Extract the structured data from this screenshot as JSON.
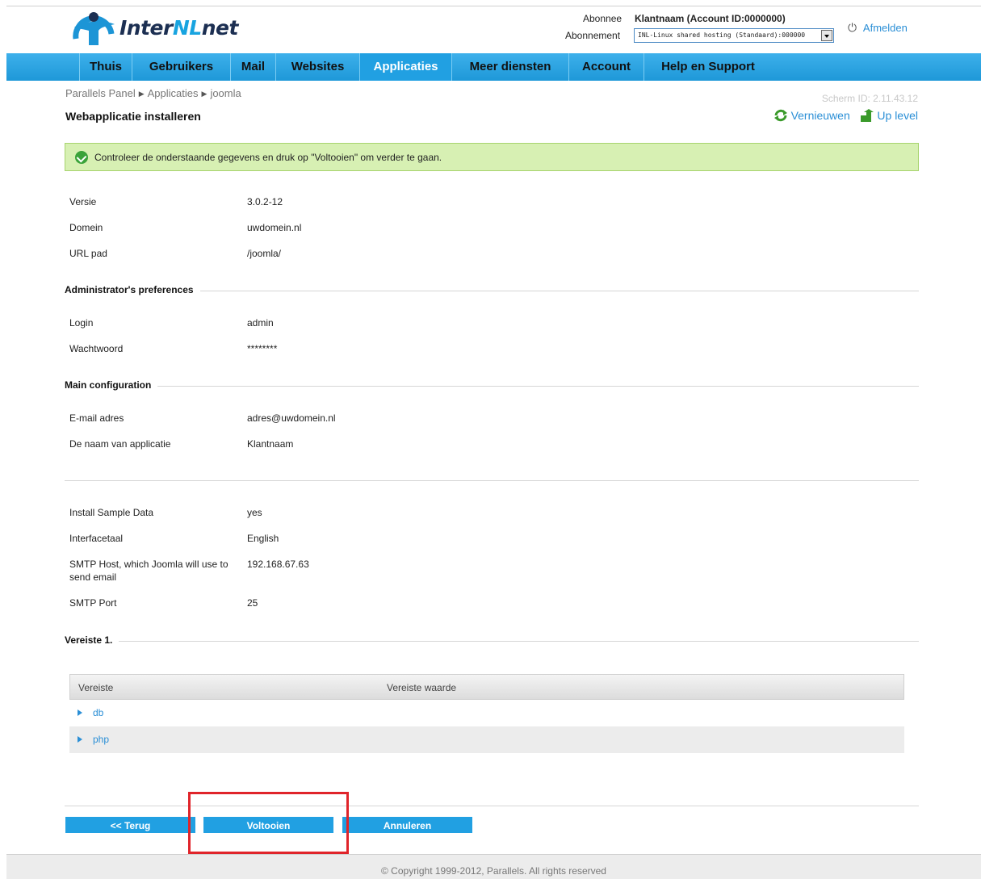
{
  "brand": {
    "logo_text_1": "Inter",
    "logo_text_2": "NL",
    "logo_text_3": "net"
  },
  "account": {
    "subscriber_label": "Abonnee",
    "subscriber_name": "Klantnaam (Account ID:0000000)",
    "subscription_label": "Abonnement",
    "subscription_value": "INL-Linux shared hosting (Standaard):000000",
    "logout_label": "Afmelden"
  },
  "nav": {
    "items": [
      {
        "label": "Thuis"
      },
      {
        "label": "Gebruikers"
      },
      {
        "label": "Mail"
      },
      {
        "label": "Websites"
      },
      {
        "label": "Applicaties"
      },
      {
        "label": "Meer diensten"
      },
      {
        "label": "Account"
      },
      {
        "label": "Help en Support"
      }
    ]
  },
  "breadcrumb": [
    "Parallels Panel",
    "Applicaties",
    "joomla"
  ],
  "screen_id": "Scherm ID:  2.11.43.12",
  "page_title": "Webapplicatie installeren",
  "tools": {
    "refresh": "Vernieuwen",
    "up": "Up level"
  },
  "message": "Controleer de onderstaande gegevens en druk op \"Voltooien\" om verder te gaan.",
  "general": [
    {
      "label": "Versie",
      "value": "3.0.2-12"
    },
    {
      "label": "Domein",
      "value": "uwdomein.nl"
    },
    {
      "label": "URL pad",
      "value": "/joomla/"
    }
  ],
  "admin_section": {
    "title": "Administrator's preferences",
    "rows": [
      {
        "label": "Login",
        "value": "admin"
      },
      {
        "label": "Wachtwoord",
        "value": "********"
      }
    ]
  },
  "main_section": {
    "title": "Main configuration",
    "rows": [
      {
        "label": "E-mail adres",
        "value": "adres@uwdomein.nl"
      },
      {
        "label": "De naam van applicatie",
        "value": "Klantnaam"
      }
    ]
  },
  "extra": [
    {
      "label": "Install Sample Data",
      "value": "yes"
    },
    {
      "label": "Interfacetaal",
      "value": "English"
    },
    {
      "label": "SMTP Host, which Joomla will use to send email",
      "value": "192.168.67.63"
    },
    {
      "label": "SMTP Port",
      "value": "25"
    }
  ],
  "requirements": {
    "title": "Vereiste 1.",
    "col1": "Vereiste",
    "col2": "Vereiste waarde",
    "rows": [
      {
        "name": "db"
      },
      {
        "name": "php"
      }
    ]
  },
  "buttons": {
    "back": "<< Terug",
    "finish": "Voltooien",
    "cancel": "Annuleren"
  },
  "footer": "© Copyright 1999-2012, Parallels. All rights reserved",
  "colors": {
    "accent": "#21a0e2",
    "link": "#2b8fd6",
    "highlight": "#e0242a",
    "success_bg": "#d7f0b3"
  }
}
